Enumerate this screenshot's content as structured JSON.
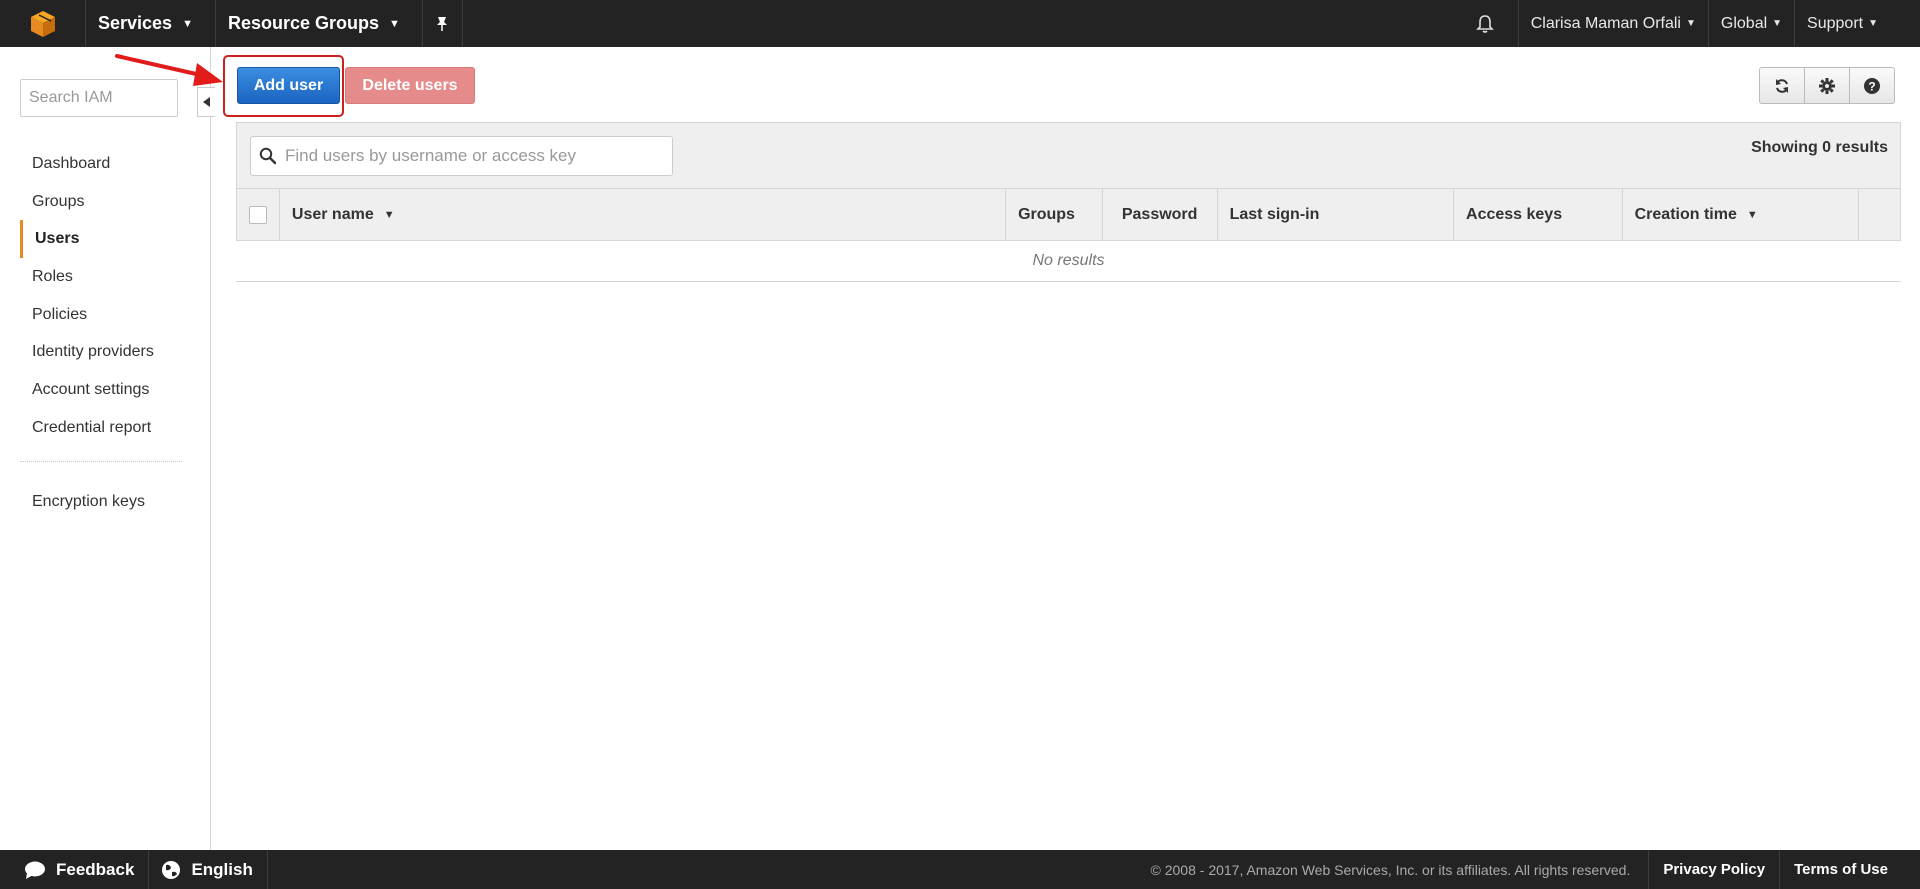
{
  "topnav": {
    "services_label": "Services",
    "resource_groups_label": "Resource Groups",
    "user_name": "Clarisa Maman Orfali",
    "region_label": "Global",
    "support_label": "Support"
  },
  "sidebar": {
    "search_placeholder": "Search IAM",
    "items": [
      {
        "label": "Dashboard"
      },
      {
        "label": "Groups"
      },
      {
        "label": "Users"
      },
      {
        "label": "Roles"
      },
      {
        "label": "Policies"
      },
      {
        "label": "Identity providers"
      },
      {
        "label": "Account settings"
      },
      {
        "label": "Credential report"
      }
    ],
    "encryption_label": "Encryption keys"
  },
  "toolbar": {
    "add_user_label": "Add user",
    "delete_users_label": "Delete users"
  },
  "table": {
    "search_placeholder": "Find users by username or access key",
    "showing_text": "Showing 0 results",
    "columns": [
      "User name",
      "Groups",
      "Password",
      "Last sign-in",
      "Access keys",
      "Creation time"
    ],
    "empty_text": "No results"
  },
  "footer": {
    "feedback_label": "Feedback",
    "language_label": "English",
    "copyright": "© 2008 - 2017, Amazon Web Services, Inc. or its affiliates. All rights reserved.",
    "privacy_label": "Privacy Policy",
    "terms_label": "Terms of Use"
  },
  "colors": {
    "nav_bg": "#232323",
    "primary_button": "#1a64c0",
    "danger_button_disabled": "#e58b8b",
    "active_accent": "#e88a22",
    "annotation_red": "#cc1f1f"
  }
}
